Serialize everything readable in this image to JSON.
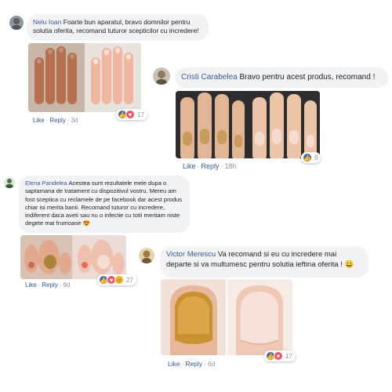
{
  "comments": [
    {
      "author": "Nelu Ioan",
      "text": "Foarte bun aparatul, bravo domnilor pentru solutia oferita, recomand tuturor scepticilor cu incredere!",
      "actions": {
        "like": "Like",
        "reply": "Reply",
        "time": "3d"
      },
      "reactions": {
        "icons": [
          "like-icon",
          "love-icon"
        ],
        "count": "17"
      }
    },
    {
      "author": "Cristi Carabelea",
      "text": "Bravo pentru acest produs, recomand !",
      "actions": {
        "like": "Like",
        "reply": "Reply",
        "time": "18h"
      },
      "reactions": {
        "icons": [
          "like-icon"
        ],
        "count": "9"
      }
    },
    {
      "author": "Elena Pandelea",
      "text": "Acestea sunt rezultatele mele dupa o saptamana de tratament cu dispozitivul vostru. Mereu am fost sceptica cu reclamele de pe facebook dar acest produs chiar isi merita banii. Recomand tuturor cu incredere, indiferent daca aveti sau nu o infectie cu totii meritam niste degete mai frumoase 😍",
      "actions": {
        "like": "Like",
        "reply": "Reply",
        "time": "9d"
      },
      "reactions": {
        "icons": [
          "like-icon",
          "love-icon",
          "wow-icon"
        ],
        "count": "27"
      }
    },
    {
      "author": "Victor Merescu",
      "text": "Va recomand si eu cu incredere mai departe si va multumesc pentru solutia ieftina oferita ! 😀",
      "actions": {
        "like": "Like",
        "reply": "Reply",
        "time": "6d"
      },
      "reactions": {
        "icons": [
          "like-icon",
          "love-icon"
        ],
        "count": "17"
      }
    }
  ],
  "colors": {
    "link": "#385898",
    "bubble": "#f2f3f5",
    "meta": "#90949c",
    "like": "#4267b2",
    "love": "#f25268",
    "wow": "#f7b125"
  }
}
